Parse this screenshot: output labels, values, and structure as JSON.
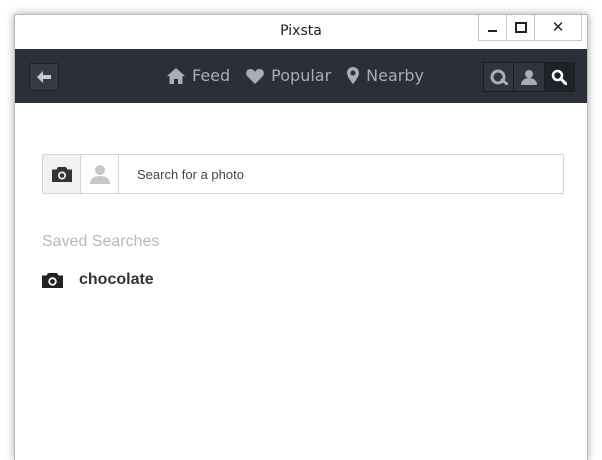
{
  "window": {
    "title": "Pixsta"
  },
  "titlebar_buttons": {
    "close_glyph": "✕"
  },
  "nav": {
    "items": [
      {
        "label": "Feed",
        "icon": "home-icon"
      },
      {
        "label": "Popular",
        "icon": "heart-icon"
      },
      {
        "label": "Nearby",
        "icon": "map-pin-icon"
      }
    ],
    "right_buttons": [
      "tag-search-icon",
      "user-search-icon",
      "search-icon"
    ],
    "active_right": "search-icon"
  },
  "search": {
    "placeholder": "Search for a photo",
    "value": "",
    "active_type": "photo"
  },
  "saved": {
    "title": "Saved Searches",
    "items": [
      {
        "label": "chocolate",
        "icon": "camera-icon"
      }
    ]
  },
  "colors": {
    "navbar": "#2b2f38",
    "nav_text": "#a8adb7",
    "saved_title": "#b9b9b9"
  }
}
